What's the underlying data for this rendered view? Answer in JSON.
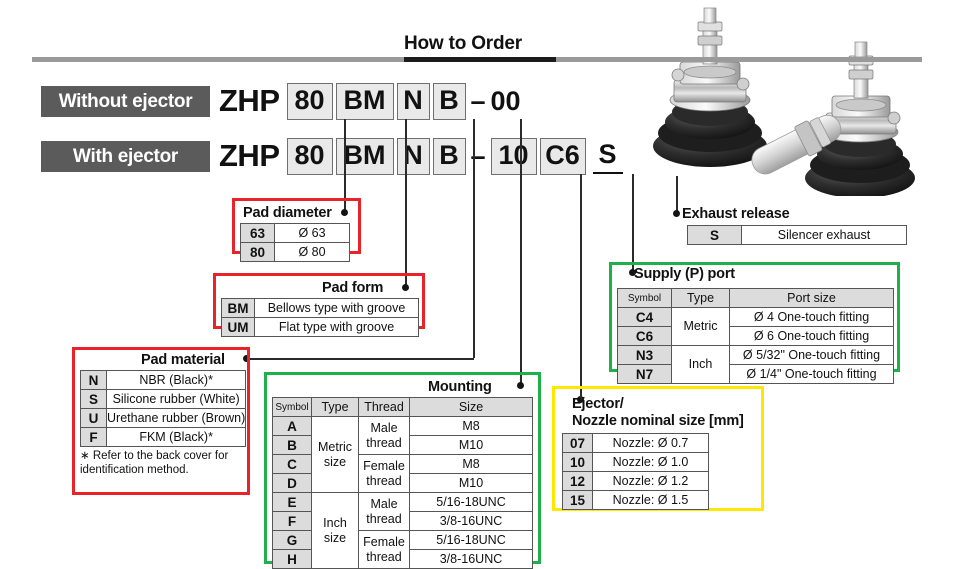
{
  "header": {
    "title": "How to Order"
  },
  "part_numbers": {
    "without": {
      "badge": "Without ejector",
      "prefix": "ZHP",
      "codes": [
        "80",
        "BM",
        "N",
        "B"
      ],
      "dash": "–",
      "suffix": "00"
    },
    "with": {
      "badge": "With ejector",
      "prefix": "ZHP",
      "codes": [
        "80",
        "BM",
        "N",
        "B"
      ],
      "dash": "–",
      "codes_after": [
        "10",
        "C6"
      ],
      "exhaust_code": "S"
    }
  },
  "callouts": {
    "pad_diameter": {
      "title": "Pad diameter",
      "border_color": "#e8232a",
      "rows": [
        {
          "symbol": "63",
          "value": "Ø 63"
        },
        {
          "symbol": "80",
          "value": "Ø 80"
        }
      ]
    },
    "pad_form": {
      "title": "Pad form",
      "border_color": "#e8232a",
      "rows": [
        {
          "symbol": "BM",
          "value": "Bellows type with groove"
        },
        {
          "symbol": "UM",
          "value": "Flat type with groove"
        }
      ]
    },
    "pad_material": {
      "title": "Pad material",
      "border_color": "#e8232a",
      "rows": [
        {
          "symbol": "N",
          "value": "NBR (Black)*"
        },
        {
          "symbol": "S",
          "value": "Silicone rubber (White)"
        },
        {
          "symbol": "U",
          "value": "Urethane rubber (Brown)"
        },
        {
          "symbol": "F",
          "value": "FKM (Black)*"
        }
      ],
      "note": "∗ Refer to the back cover for identification method."
    },
    "mounting": {
      "title": "Mounting",
      "border_color": "#1faf4b",
      "headers": [
        "Symbol",
        "Type",
        "Thread",
        "Size"
      ],
      "rows": [
        {
          "symbol": "A",
          "type": "Metric size",
          "thread": "Male thread",
          "size": "M8"
        },
        {
          "symbol": "B",
          "type": "",
          "thread": "",
          "size": "M10"
        },
        {
          "symbol": "C",
          "type": "",
          "thread": "Female thread",
          "size": "M8"
        },
        {
          "symbol": "D",
          "type": "",
          "thread": "",
          "size": "M10"
        },
        {
          "symbol": "E",
          "type": "Inch size",
          "thread": "Male thread",
          "size": "5/16-18UNC"
        },
        {
          "symbol": "F",
          "type": "",
          "thread": "",
          "size": "3/8-16UNC"
        },
        {
          "symbol": "G",
          "type": "",
          "thread": "Female thread",
          "size": "5/16-18UNC"
        },
        {
          "symbol": "H",
          "type": "",
          "thread": "",
          "size": "3/8-16UNC"
        }
      ],
      "type_metric_line1": "Metric",
      "type_metric_line2": "size",
      "type_inch_line1": "Inch",
      "type_inch_line2": "size",
      "thread_male_line1": "Male",
      "thread_male_line2": "thread",
      "thread_female_line1": "Female",
      "thread_female_line2": "thread"
    },
    "supply_port": {
      "title": "Supply (P) port",
      "border_color": "#1faf4b",
      "headers": [
        "Symbol",
        "Type",
        "Port size"
      ],
      "rows": [
        {
          "symbol": "C4",
          "type": "Metric",
          "size": "Ø 4 One-touch fitting"
        },
        {
          "symbol": "C6",
          "type": "",
          "size": "Ø 6 One-touch fitting"
        },
        {
          "symbol": "N3",
          "type": "Inch",
          "size": "Ø 5/32\" One-touch fitting"
        },
        {
          "symbol": "N7",
          "type": "",
          "size": "Ø 1/4\" One-touch fitting"
        }
      ]
    },
    "ejector_nozzle": {
      "title_line1": "Ejector/",
      "title_line2": "Nozzle nominal size [mm]",
      "border_color": "#ffe800",
      "rows": [
        {
          "symbol": "07",
          "value": "Nozzle: Ø 0.7"
        },
        {
          "symbol": "10",
          "value": "Nozzle: Ø 1.0"
        },
        {
          "symbol": "12",
          "value": "Nozzle: Ø 1.2"
        },
        {
          "symbol": "15",
          "value": "Nozzle: Ø 1.5"
        }
      ]
    },
    "exhaust_release": {
      "title": "Exhaust release",
      "rows": [
        {
          "symbol": "S",
          "value": "Silencer exhaust"
        }
      ]
    }
  }
}
